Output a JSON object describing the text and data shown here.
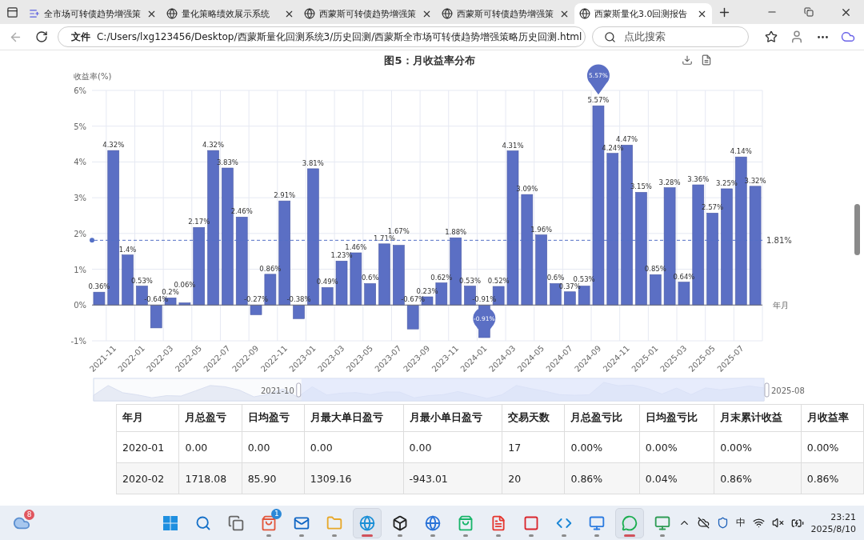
{
  "browser": {
    "tabs": [
      {
        "kind": "app",
        "title": "全市场可转债趋势增强策",
        "selected": false
      },
      {
        "kind": "globe",
        "title": "量化策略绩效展示系统",
        "selected": false
      },
      {
        "kind": "globe",
        "title": "西蒙斯可转债趋势增强策",
        "selected": false
      },
      {
        "kind": "globe",
        "title": "西蒙斯可转债趋势增强策",
        "selected": false
      },
      {
        "kind": "globe",
        "title": "西蒙斯量化3.0回测报告",
        "selected": true
      }
    ],
    "address": {
      "scheme": "文件",
      "url": "C:/Users/lxg123456/Desktop/西蒙斯量化回测系统3/历史回测/西蒙斯全市场可转债趋势增强策略历史回测.html"
    },
    "search": {
      "placeholder": "点此搜索"
    }
  },
  "monthly_chart": {
    "title": "图5：月收益率分布",
    "chart_data": {
      "type": "bar",
      "ylabel": "收益率(%)",
      "xlabel": "年月",
      "categories": [
        null,
        "2021-11",
        null,
        "2022-01",
        null,
        "2022-03",
        null,
        "2022-05",
        null,
        "2022-07",
        null,
        "2022-09",
        null,
        "2022-11",
        null,
        "2023-01",
        null,
        "2023-03",
        null,
        "2023-05",
        null,
        "2023-07",
        null,
        "2023-09",
        null,
        "2023-11",
        null,
        "2024-01",
        null,
        "2024-03",
        null,
        "2024-05",
        null,
        "2024-07",
        null,
        "2024-09",
        null,
        "2024-11",
        null,
        "2025-01",
        null,
        "2025-03",
        null,
        "2025-05",
        null,
        "2025-07",
        null
      ],
      "grid": true,
      "values": [
        0.36,
        4.32,
        1.4,
        0.53,
        -0.64,
        0.2,
        0.06,
        2.17,
        4.32,
        3.83,
        2.46,
        -0.27,
        0.86,
        2.91,
        -0.38,
        3.81,
        0.49,
        1.23,
        1.46,
        0.6,
        1.71,
        1.67,
        -0.67,
        0.23,
        0.62,
        1.88,
        0.53,
        -0.91,
        0.52,
        4.31,
        3.09,
        1.96,
        0.6,
        0.37,
        0.53,
        5.57,
        4.24,
        4.47,
        3.15,
        0.85,
        3.28,
        0.64,
        3.36,
        2.57,
        3.25,
        4.14,
        3.32
      ],
      "value_labels": [
        "0.36%",
        "4.32%",
        "1.4%",
        "0.53%",
        "-0.64%",
        "0.2%",
        "0.06%",
        "2.17%",
        "4.32%",
        "3.83%",
        "2.46%",
        "-0.27%",
        "0.86%",
        "2.91%",
        "-0.38%",
        "3.81%",
        "0.49%",
        "1.23%",
        "1.46%",
        "0.6%",
        "1.71%",
        "1.67%",
        "-0.67%",
        "0.23%",
        "0.62%",
        "1.88%",
        "0.53%",
        "-0.91%",
        "0.52%",
        "4.31%",
        "3.09%",
        "1.96%",
        "0.6%",
        "0.37%",
        "0.53%",
        "5.57%",
        "4.24%",
        "4.47%",
        "3.15%",
        "0.85%",
        "3.28%",
        "0.64%",
        "3.36%",
        "2.57%",
        "3.25%",
        "4.14%",
        "3.32%"
      ],
      "ylim": [
        -1,
        6
      ],
      "yticks": [
        {
          "value": -1,
          "label": "-1%"
        },
        {
          "value": 0,
          "label": "0%"
        },
        {
          "value": 1,
          "label": "1%"
        },
        {
          "value": 2,
          "label": "2%"
        },
        {
          "value": 3,
          "label": "3%"
        },
        {
          "value": 4,
          "label": "4%"
        },
        {
          "value": 5,
          "label": "5%"
        },
        {
          "value": 6,
          "label": "6%"
        }
      ],
      "ref_lines": [
        {
          "axis": "y",
          "value": 1.81,
          "label": "1.81%"
        }
      ],
      "data_labels": true
    },
    "pins": [
      {
        "kind": "max",
        "text": "5.57%"
      },
      {
        "kind": "min",
        "text": "-0.91%"
      }
    ],
    "data_zoom": {
      "start_label": "2021-10",
      "end_label": "2025-08",
      "level": 0.69
    }
  },
  "table": {
    "columns": [
      "年月",
      "月总盈亏",
      "日均盈亏",
      "月最大单日盈亏",
      "月最小单日盈亏",
      "交易天数",
      "月总盈亏比",
      "日均盈亏比",
      "月末累计收益",
      "月收益率"
    ],
    "rows": [
      [
        "2020-01",
        "0.00",
        "0.00",
        "0.00",
        "0.00",
        "17",
        "0.00%",
        "0.00%",
        "0.00%",
        "0.00%"
      ],
      [
        "2020-02",
        "1718.08",
        "85.90",
        "1309.16",
        "-943.01",
        "20",
        "0.86%",
        "0.04%",
        "0.86%",
        "0.86%"
      ]
    ]
  },
  "taskbar": {
    "weather_badge": "8",
    "apps": [
      {
        "kind": "start",
        "running": false,
        "active": false
      },
      {
        "kind": "search",
        "running": false,
        "active": false
      },
      {
        "kind": "taskview",
        "running": false,
        "active": false
      },
      {
        "kind": "store",
        "running": true,
        "active": false,
        "badge": "1"
      },
      {
        "kind": "mail",
        "running": true,
        "active": false
      },
      {
        "kind": "folder",
        "running": true,
        "active": false
      },
      {
        "kind": "browser",
        "running": true,
        "active": true
      },
      {
        "kind": "cube",
        "running": true,
        "active": false
      },
      {
        "kind": "browser2",
        "running": true,
        "active": false
      },
      {
        "kind": "bag",
        "running": true,
        "active": false
      },
      {
        "kind": "wps",
        "running": true,
        "active": false
      },
      {
        "kind": "red",
        "running": true,
        "active": false
      },
      {
        "kind": "code",
        "running": true,
        "active": false
      },
      {
        "kind": "blue",
        "running": true,
        "active": false
      },
      {
        "kind": "chat",
        "running": true,
        "active": true
      },
      {
        "kind": "remote",
        "running": true,
        "active": false
      }
    ],
    "ime": "中",
    "time": "23:21",
    "date": "2025/8/10"
  }
}
